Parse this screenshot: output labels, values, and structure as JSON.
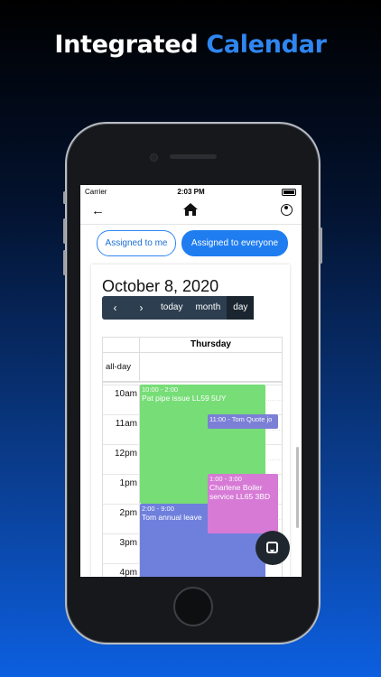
{
  "headline": {
    "part1": "Integrated",
    "part2": "Calendar"
  },
  "status_bar": {
    "carrier": "Carrier",
    "time": "2:03 PM"
  },
  "nav": {
    "back_icon": "arrow-left-icon",
    "home_icon": "home-icon",
    "profile_icon": "user-circle-icon"
  },
  "filters": {
    "assigned_to_me": "Assigned to me",
    "assigned_to_everyone": "Assigned to everyone",
    "active": "assigned_to_everyone"
  },
  "calendar": {
    "date_title": "October 8, 2020",
    "toolbar": {
      "prev": "‹",
      "next": "›",
      "today": "today",
      "month": "month",
      "day": "day",
      "active_view": "day"
    },
    "day_header": "Thursday",
    "allday_label": "all-day",
    "hours": [
      "10am",
      "11am",
      "12pm",
      "1pm",
      "2pm",
      "3pm",
      "4pm"
    ],
    "events": [
      {
        "time": "10:00 - 2:00",
        "title": "Pat pipe issue LL59 5UY",
        "color": "#77dd77"
      },
      {
        "time": "11:00 - Tom Quote jo",
        "title": "",
        "color": "#7b7fd6"
      },
      {
        "time": "1:00 - 3:00",
        "title": "Charlene Boiler service LL65 3BD",
        "color": "#d67ad6"
      },
      {
        "time": "2:00 - 9:00",
        "title": "Tom annual leave",
        "color": "#6f7fdc"
      }
    ]
  },
  "colors": {
    "accent": "#1f7df0",
    "toolbar_bg": "#2c3e50",
    "headline_blue": "#2f86f0"
  },
  "chat_icon": "chat-bubble-icon"
}
